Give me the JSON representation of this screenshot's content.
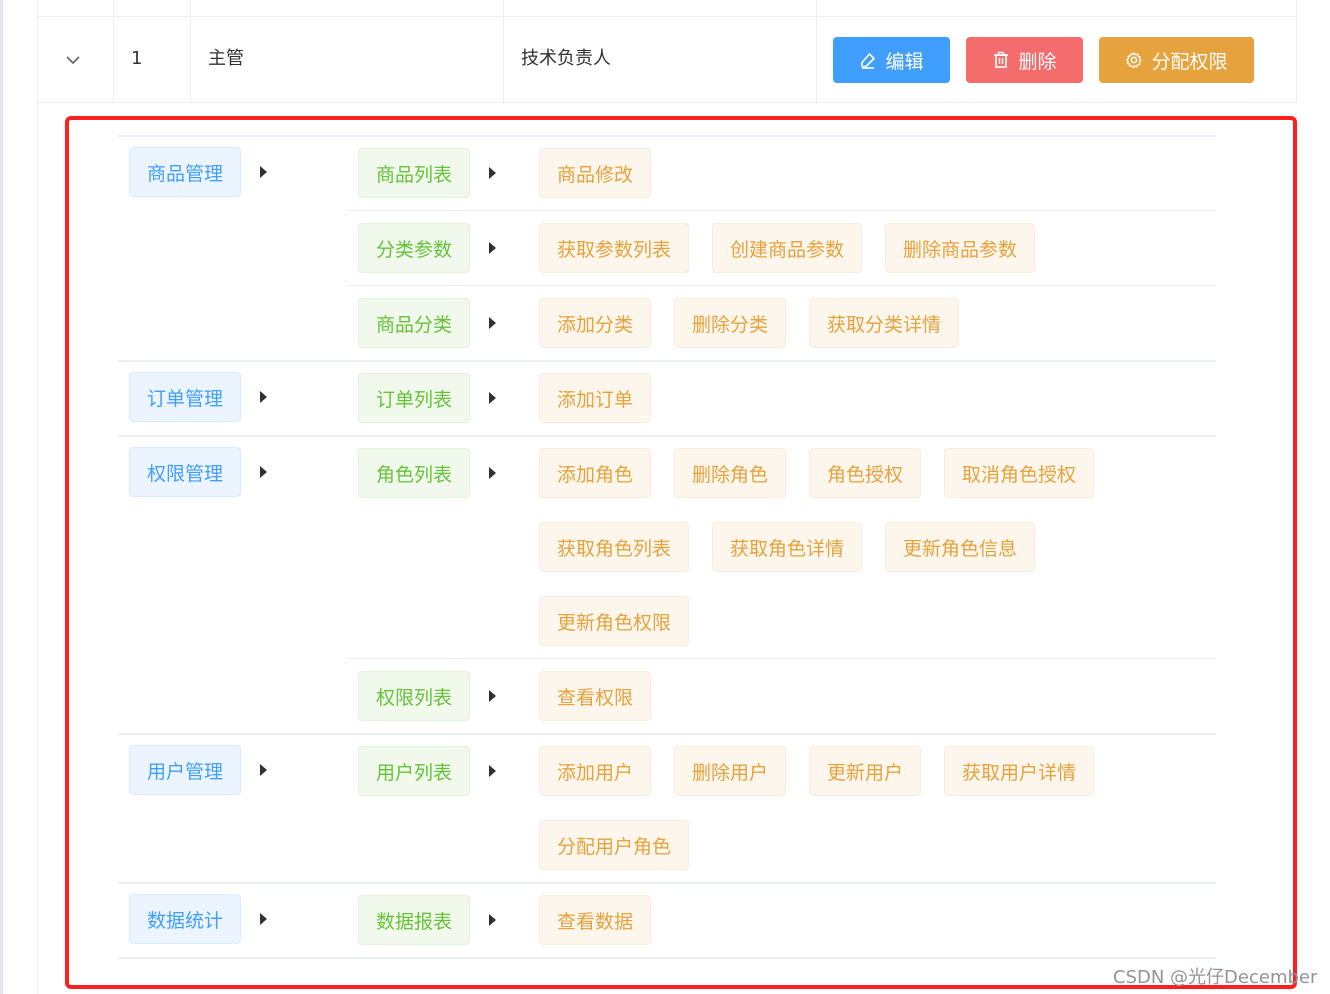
{
  "table_row": {
    "index": "1",
    "role_name": "主管",
    "role_desc": "技术负责人"
  },
  "actions": {
    "edit_label": "编辑",
    "delete_label": "删除",
    "assign_label": "分配权限"
  },
  "permissions": [
    {
      "name": "商品管理",
      "children": [
        {
          "name": "商品列表",
          "rows": [
            [
              "商品修改"
            ]
          ]
        },
        {
          "name": "分类参数",
          "rows": [
            [
              "获取参数列表",
              "创建商品参数",
              "删除商品参数"
            ]
          ]
        },
        {
          "name": "商品分类",
          "rows": [
            [
              "添加分类",
              "删除分类",
              "获取分类详情"
            ]
          ]
        }
      ]
    },
    {
      "name": "订单管理",
      "children": [
        {
          "name": "订单列表",
          "rows": [
            [
              "添加订单"
            ]
          ]
        }
      ]
    },
    {
      "name": "权限管理",
      "children": [
        {
          "name": "角色列表",
          "rows": [
            [
              "添加角色",
              "删除角色",
              "角色授权",
              "取消角色授权"
            ],
            [
              "获取角色列表",
              "获取角色详情",
              "更新角色信息"
            ],
            [
              "更新角色权限"
            ]
          ]
        },
        {
          "name": "权限列表",
          "rows": [
            [
              "查看权限"
            ]
          ]
        }
      ]
    },
    {
      "name": "用户管理",
      "children": [
        {
          "name": "用户列表",
          "rows": [
            [
              "添加用户",
              "删除用户",
              "更新用户",
              "获取用户详情"
            ],
            [
              "分配用户角色"
            ]
          ]
        }
      ]
    },
    {
      "name": "数据统计",
      "children": [
        {
          "name": "数据报表",
          "rows": [
            [
              "查看数据"
            ]
          ]
        }
      ]
    }
  ],
  "colors": {
    "primary": "#409eff",
    "danger": "#f56c6c",
    "warning": "#e6a23c",
    "success": "#67c23a",
    "highlight": "#ff1f1f"
  },
  "watermark": "CSDN @光仔December"
}
